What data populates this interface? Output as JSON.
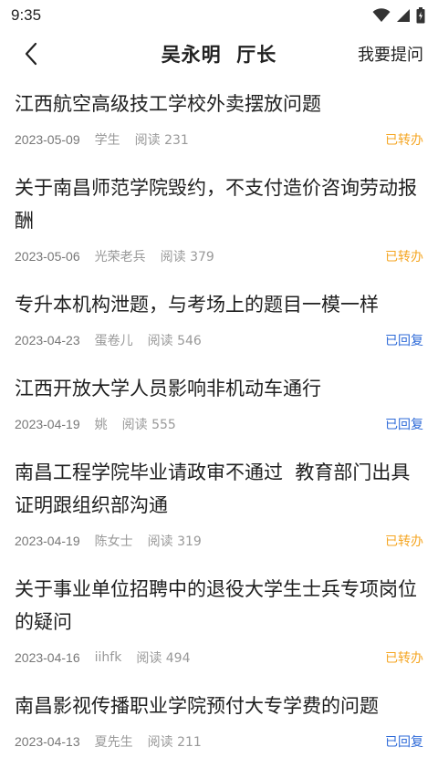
{
  "status_bar": {
    "time": "9:35"
  },
  "nav": {
    "title": "吴永明  厅长",
    "ask_label": "我要提问"
  },
  "items": [
    {
      "title": "江西航空高级技工学校外卖摆放问题",
      "date": "2023-05-09",
      "author": "学生",
      "read": "阅读 231",
      "status": "已转办"
    },
    {
      "title": "关于南昌师范学院毁约，不支付造价咨询劳动报酬",
      "date": "2023-05-06",
      "author": "光荣老兵",
      "read": "阅读 379",
      "status": "已转办"
    },
    {
      "title": "专升本机构泄题，与考场上的题目一模一样",
      "date": "2023-04-23",
      "author": "蛋卷儿",
      "read": "阅读 546",
      "status": "已回复"
    },
    {
      "title": "江西开放大学人员影响非机动车通行",
      "date": "2023-04-19",
      "author": "姚",
      "read": "阅读 555",
      "status": "已回复"
    },
    {
      "title": "南昌工程学院毕业请政审不通过  教育部门出具证明跟组织部沟通",
      "date": "2023-04-19",
      "author": "陈女士",
      "read": "阅读 319",
      "status": "已转办"
    },
    {
      "title": "关于事业单位招聘中的退役大学生士兵专项岗位的疑问",
      "date": "2023-04-16",
      "author": "iihfk",
      "read": "阅读 494",
      "status": "已转办"
    },
    {
      "title": "南昌影视传播职业学院预付大专学费的问题",
      "date": "2023-04-13",
      "author": "夏先生",
      "read": "阅读 211",
      "status": "已回复"
    }
  ],
  "colors": {
    "forwarded": "#f5a623",
    "replied": "#2f6bd8"
  }
}
